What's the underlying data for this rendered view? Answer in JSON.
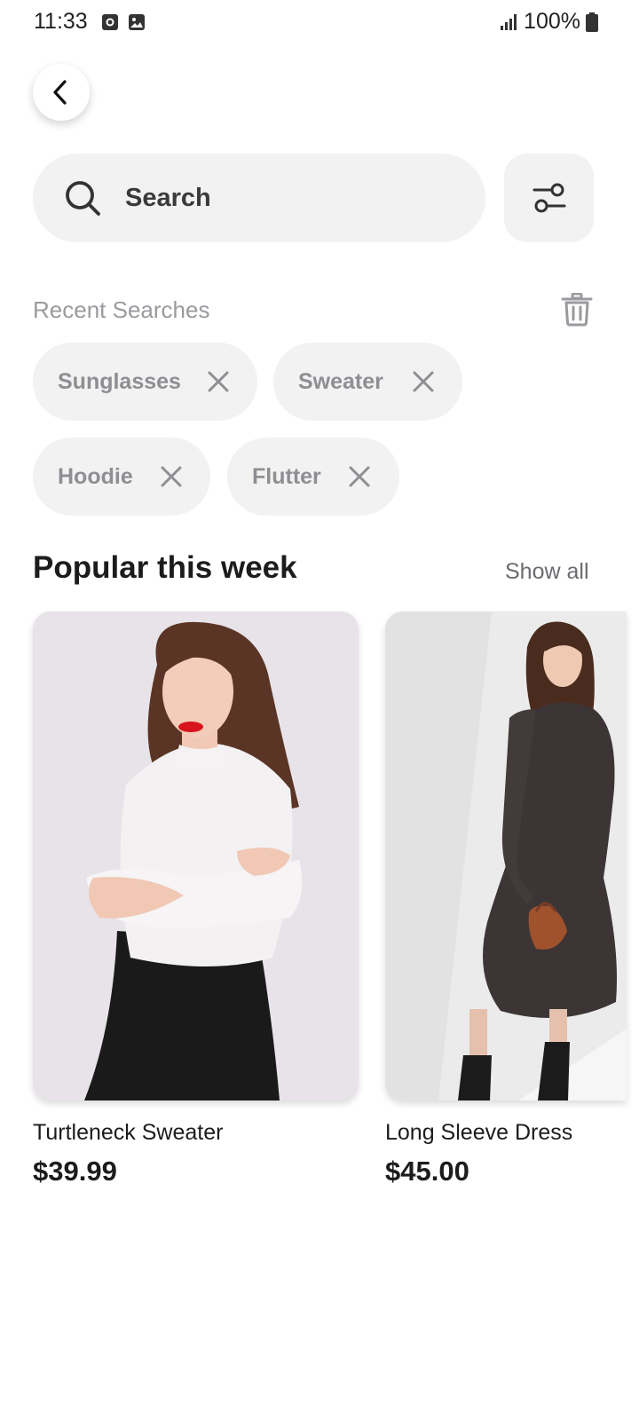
{
  "status_bar": {
    "time": "11:33",
    "battery": "100%"
  },
  "search": {
    "placeholder": "Search"
  },
  "recent": {
    "title": "Recent Searches",
    "chips": [
      "Sunglasses",
      "Sweater",
      "Hoodie",
      "Flutter"
    ]
  },
  "popular": {
    "title": "Popular this week",
    "show_all": "Show all",
    "products": [
      {
        "name": "Turtleneck Sweater",
        "price": "$39.99"
      },
      {
        "name": "Long Sleeve Dress",
        "price": "$45.00"
      }
    ]
  },
  "colors": {
    "surface": "#f2f2f2",
    "muted_text": "#9a9a9f",
    "primary_text": "#1c1c1e"
  }
}
